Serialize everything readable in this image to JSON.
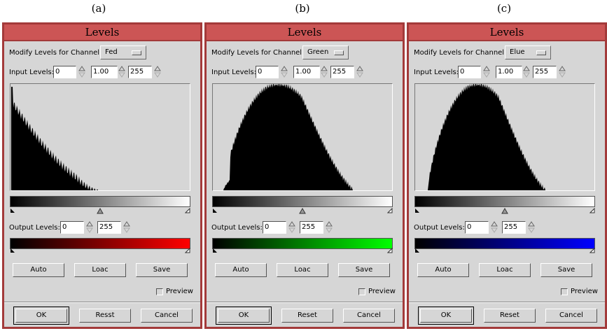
{
  "captions": [
    "(a)",
    "(b)",
    "(c)"
  ],
  "dialogs": [
    {
      "title": "Levels",
      "channel_label": "Modify Levels for Channel:",
      "channel_value": "Fed",
      "input_label": "Input Levels:",
      "input_low": "0",
      "input_gamma": "1.00",
      "input_high": "255",
      "output_label": "Output Levels:",
      "output_low": "0",
      "output_high": "255",
      "output_color": "#ff0000",
      "buttons": {
        "auto": "Auto",
        "load": "Loac",
        "save": "Save"
      },
      "preview_label": "Preview",
      "footer": {
        "ok": "OK",
        "reset": "Resst",
        "cancel": "Cancel"
      }
    },
    {
      "title": "Levels",
      "channel_label": "Modify Levels for Channel:",
      "channel_value": "Green",
      "input_label": "Input Levels:",
      "input_low": "0",
      "input_gamma": "1.00",
      "input_high": "255",
      "output_label": "Output Levels:",
      "output_low": "0",
      "output_high": "255",
      "output_color": "#00ff00",
      "buttons": {
        "auto": "Auto",
        "load": "Loac",
        "save": "Save"
      },
      "preview_label": "Preview",
      "footer": {
        "ok": "OK",
        "reset": "Reset",
        "cancel": "Cancel"
      }
    },
    {
      "title": "Levels",
      "channel_label": "Modify Levels for Channel:",
      "channel_value": "Elue",
      "input_label": "Input Levels:",
      "input_low": "0",
      "input_gamma": "1.00",
      "input_high": "255",
      "output_label": "Output Levels:",
      "output_low": "0",
      "output_high": "255",
      "output_color": "#0000ff",
      "buttons": {
        "auto": "Auto",
        "load": "Loac",
        "save": "Save"
      },
      "preview_label": "Preview",
      "footer": {
        "ok": "OK",
        "reset": "Reset",
        "cancel": "Cancel"
      }
    }
  ]
}
